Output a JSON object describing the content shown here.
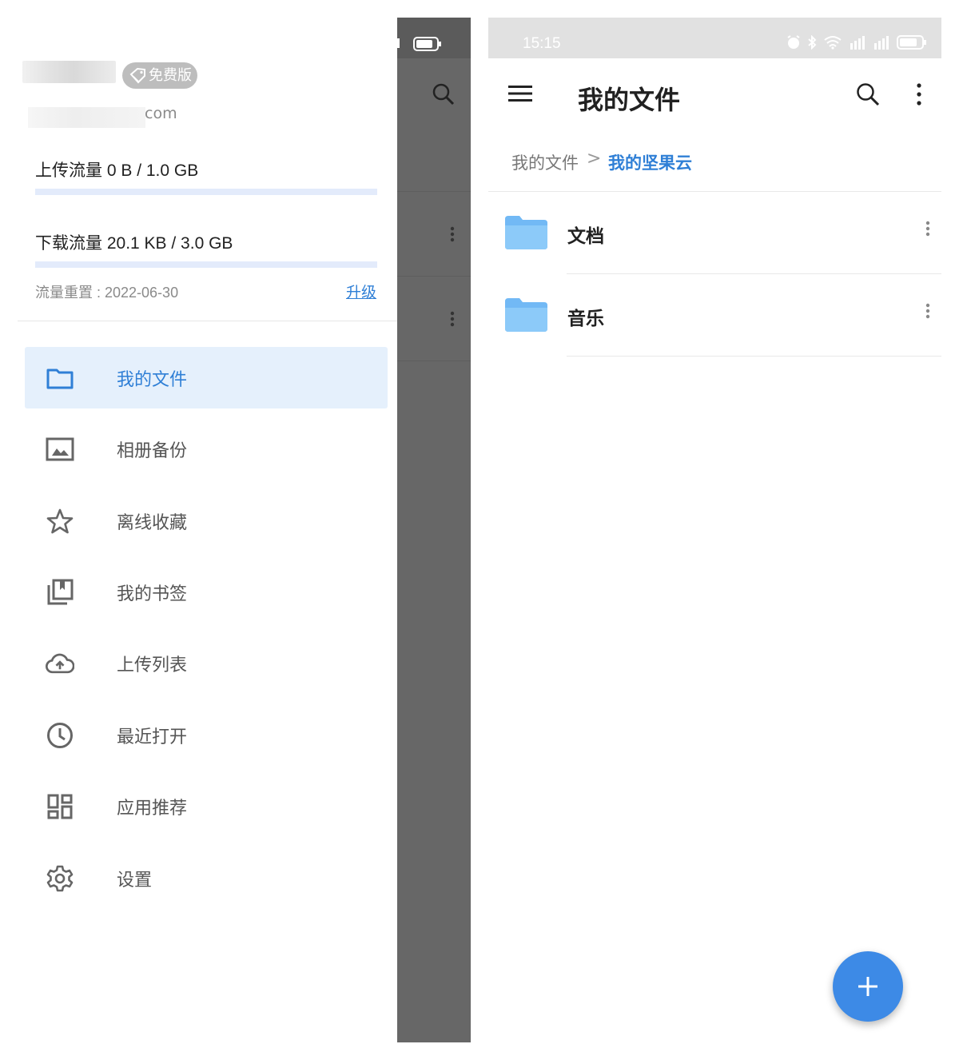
{
  "drawer": {
    "badge": "免费版",
    "email_tail": "com",
    "upload_quota": "上传流量 0 B / 1.0 GB",
    "upload_progress": 0,
    "download_quota": "下载流量 20.1 KB / 3.0 GB",
    "download_progress": 0.0,
    "reset": "流量重置 : 2022-06-30",
    "upgrade": "升级",
    "menu": [
      {
        "label": "我的文件",
        "icon": "folder-icon",
        "active": true
      },
      {
        "label": "相册备份",
        "icon": "image-icon"
      },
      {
        "label": "离线收藏",
        "icon": "star-icon"
      },
      {
        "label": "我的书签",
        "icon": "bookmark-icon"
      },
      {
        "label": "上传列表",
        "icon": "cloud-upload-icon"
      },
      {
        "label": "最近打开",
        "icon": "clock-icon"
      },
      {
        "label": "应用推荐",
        "icon": "apps-grid-icon"
      },
      {
        "label": "设置",
        "icon": "gear-icon"
      }
    ],
    "accent": "#2f7fd6"
  },
  "phone": {
    "status_time": "15:15",
    "title": "我的文件",
    "breadcrumb": [
      "我的文件",
      "我的坚果云"
    ],
    "breadcrumb_sep": ">",
    "files": [
      {
        "name": "文档",
        "icon": "folder-icon"
      },
      {
        "name": "音乐",
        "icon": "folder-icon"
      }
    ],
    "fab_icon": "plus-icon",
    "fab_color": "#3d8ae6"
  }
}
